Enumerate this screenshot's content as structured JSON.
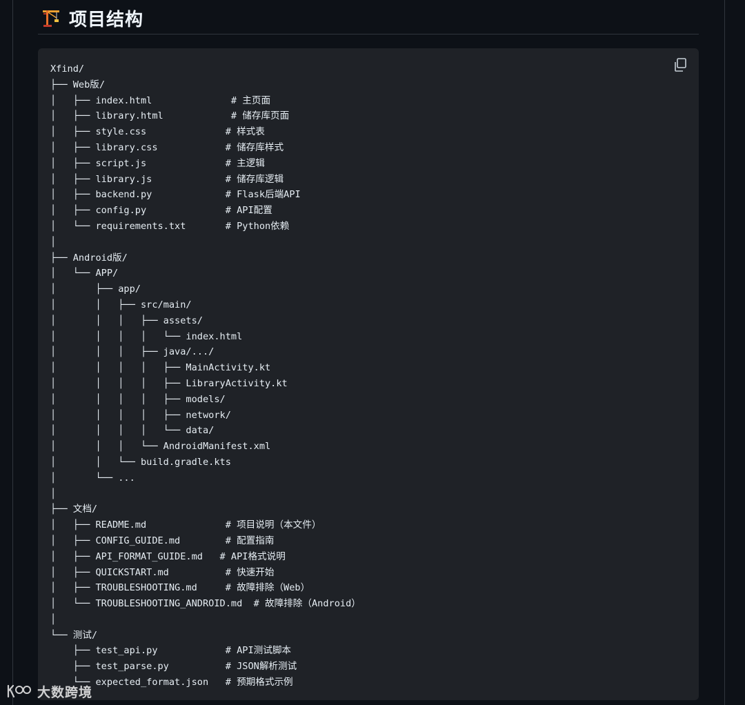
{
  "section": {
    "icon": "construction-crane-icon",
    "title": "项目结构"
  },
  "code_block": {
    "copy_icon": "copy-icon",
    "lines": [
      "Xfind/",
      "├── Web版/",
      "│   ├── index.html              # 主页面",
      "│   ├── library.html            # 储存库页面",
      "│   ├── style.css              # 样式表",
      "│   ├── library.css            # 储存库样式",
      "│   ├── script.js              # 主逻辑",
      "│   ├── library.js             # 储存库逻辑",
      "│   ├── backend.py             # Flask后端API",
      "│   ├── config.py              # API配置",
      "│   └── requirements.txt       # Python依赖",
      "│",
      "├── Android版/",
      "│   └── APP/",
      "│       ├── app/",
      "│       │   ├── src/main/",
      "│       │   │   ├── assets/",
      "│       │   │   │   └── index.html",
      "│       │   │   ├── java/.../",
      "│       │   │   │   ├── MainActivity.kt",
      "│       │   │   │   ├── LibraryActivity.kt",
      "│       │   │   │   ├── models/",
      "│       │   │   │   ├── network/",
      "│       │   │   │   └── data/",
      "│       │   │   └── AndroidManifest.xml",
      "│       │   └── build.gradle.kts",
      "│       └── ...",
      "│",
      "├── 文档/",
      "│   ├── README.md              # 项目说明（本文件）",
      "│   ├── CONFIG_GUIDE.md        # 配置指南",
      "│   ├── API_FORMAT_GUIDE.md   # API格式说明",
      "│   ├── QUICKSTART.md          # 快速开始",
      "│   ├── TROUBLESHOOTING.md     # 故障排除（Web）",
      "│   └── TROUBLESHOOTING_ANDROID.md  # 故障排除（Android）",
      "│",
      "└── 测试/",
      "    ├── test_api.py            # API测试脚本",
      "    ├── test_parse.py          # JSON解析测试",
      "    └── expected_format.json   # 预期格式示例"
    ]
  },
  "watermark": {
    "logo": "kuajing-logo",
    "text": "大数跨境"
  },
  "colors": {
    "page_background": "#0d1117",
    "code_background": "#1f2227",
    "text": "#e6edf3",
    "divider": "#30363d"
  }
}
